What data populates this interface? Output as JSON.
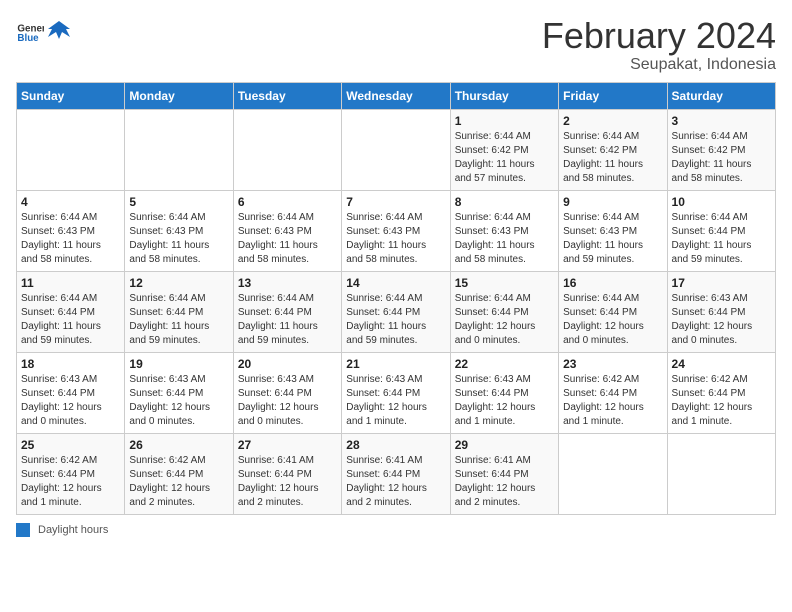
{
  "header": {
    "logo_general": "General",
    "logo_blue": "Blue",
    "month_title": "February 2024",
    "location": "Seupakat, Indonesia"
  },
  "weekdays": [
    "Sunday",
    "Monday",
    "Tuesday",
    "Wednesday",
    "Thursday",
    "Friday",
    "Saturday"
  ],
  "weeks": [
    [
      {
        "day": "",
        "info": ""
      },
      {
        "day": "",
        "info": ""
      },
      {
        "day": "",
        "info": ""
      },
      {
        "day": "",
        "info": ""
      },
      {
        "day": "1",
        "info": "Sunrise: 6:44 AM\nSunset: 6:42 PM\nDaylight: 11 hours\nand 57 minutes."
      },
      {
        "day": "2",
        "info": "Sunrise: 6:44 AM\nSunset: 6:42 PM\nDaylight: 11 hours\nand 58 minutes."
      },
      {
        "day": "3",
        "info": "Sunrise: 6:44 AM\nSunset: 6:42 PM\nDaylight: 11 hours\nand 58 minutes."
      }
    ],
    [
      {
        "day": "4",
        "info": "Sunrise: 6:44 AM\nSunset: 6:43 PM\nDaylight: 11 hours\nand 58 minutes."
      },
      {
        "day": "5",
        "info": "Sunrise: 6:44 AM\nSunset: 6:43 PM\nDaylight: 11 hours\nand 58 minutes."
      },
      {
        "day": "6",
        "info": "Sunrise: 6:44 AM\nSunset: 6:43 PM\nDaylight: 11 hours\nand 58 minutes."
      },
      {
        "day": "7",
        "info": "Sunrise: 6:44 AM\nSunset: 6:43 PM\nDaylight: 11 hours\nand 58 minutes."
      },
      {
        "day": "8",
        "info": "Sunrise: 6:44 AM\nSunset: 6:43 PM\nDaylight: 11 hours\nand 58 minutes."
      },
      {
        "day": "9",
        "info": "Sunrise: 6:44 AM\nSunset: 6:43 PM\nDaylight: 11 hours\nand 59 minutes."
      },
      {
        "day": "10",
        "info": "Sunrise: 6:44 AM\nSunset: 6:44 PM\nDaylight: 11 hours\nand 59 minutes."
      }
    ],
    [
      {
        "day": "11",
        "info": "Sunrise: 6:44 AM\nSunset: 6:44 PM\nDaylight: 11 hours\nand 59 minutes."
      },
      {
        "day": "12",
        "info": "Sunrise: 6:44 AM\nSunset: 6:44 PM\nDaylight: 11 hours\nand 59 minutes."
      },
      {
        "day": "13",
        "info": "Sunrise: 6:44 AM\nSunset: 6:44 PM\nDaylight: 11 hours\nand 59 minutes."
      },
      {
        "day": "14",
        "info": "Sunrise: 6:44 AM\nSunset: 6:44 PM\nDaylight: 11 hours\nand 59 minutes."
      },
      {
        "day": "15",
        "info": "Sunrise: 6:44 AM\nSunset: 6:44 PM\nDaylight: 12 hours\nand 0 minutes."
      },
      {
        "day": "16",
        "info": "Sunrise: 6:44 AM\nSunset: 6:44 PM\nDaylight: 12 hours\nand 0 minutes."
      },
      {
        "day": "17",
        "info": "Sunrise: 6:43 AM\nSunset: 6:44 PM\nDaylight: 12 hours\nand 0 minutes."
      }
    ],
    [
      {
        "day": "18",
        "info": "Sunrise: 6:43 AM\nSunset: 6:44 PM\nDaylight: 12 hours\nand 0 minutes."
      },
      {
        "day": "19",
        "info": "Sunrise: 6:43 AM\nSunset: 6:44 PM\nDaylight: 12 hours\nand 0 minutes."
      },
      {
        "day": "20",
        "info": "Sunrise: 6:43 AM\nSunset: 6:44 PM\nDaylight: 12 hours\nand 0 minutes."
      },
      {
        "day": "21",
        "info": "Sunrise: 6:43 AM\nSunset: 6:44 PM\nDaylight: 12 hours\nand 1 minute."
      },
      {
        "day": "22",
        "info": "Sunrise: 6:43 AM\nSunset: 6:44 PM\nDaylight: 12 hours\nand 1 minute."
      },
      {
        "day": "23",
        "info": "Sunrise: 6:42 AM\nSunset: 6:44 PM\nDaylight: 12 hours\nand 1 minute."
      },
      {
        "day": "24",
        "info": "Sunrise: 6:42 AM\nSunset: 6:44 PM\nDaylight: 12 hours\nand 1 minute."
      }
    ],
    [
      {
        "day": "25",
        "info": "Sunrise: 6:42 AM\nSunset: 6:44 PM\nDaylight: 12 hours\nand 1 minute."
      },
      {
        "day": "26",
        "info": "Sunrise: 6:42 AM\nSunset: 6:44 PM\nDaylight: 12 hours\nand 2 minutes."
      },
      {
        "day": "27",
        "info": "Sunrise: 6:41 AM\nSunset: 6:44 PM\nDaylight: 12 hours\nand 2 minutes."
      },
      {
        "day": "28",
        "info": "Sunrise: 6:41 AM\nSunset: 6:44 PM\nDaylight: 12 hours\nand 2 minutes."
      },
      {
        "day": "29",
        "info": "Sunrise: 6:41 AM\nSunset: 6:44 PM\nDaylight: 12 hours\nand 2 minutes."
      },
      {
        "day": "",
        "info": ""
      },
      {
        "day": "",
        "info": ""
      }
    ]
  ],
  "legend": {
    "box_label": "Daylight hours"
  }
}
